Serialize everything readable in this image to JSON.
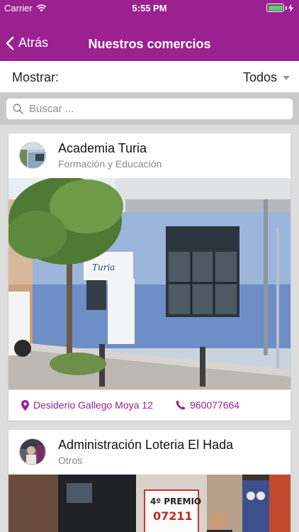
{
  "status_bar": {
    "carrier": "Carrier",
    "time": "5:55 PM",
    "wifi_icon": "wifi-icon",
    "battery_icon": "battery-charging-icon"
  },
  "nav": {
    "back_label": "Atrás",
    "title": "Nuestros comercios"
  },
  "filter": {
    "label": "Mostrar:",
    "selected": "Todos"
  },
  "search": {
    "placeholder": "Buscar ..."
  },
  "businesses": [
    {
      "name": "Academia Turia",
      "category": "Formación y Educación",
      "address": "Desiderio Gallego Moya 12",
      "phone": "960077664",
      "sign_text": "Turia"
    },
    {
      "name": "Administración Loteria El Hada",
      "category": "Otros",
      "sign_text_1": "4º PREMIO",
      "sign_text_2": "07211"
    }
  ],
  "colors": {
    "brand": "#9b2190",
    "background": "#dddddd",
    "battery": "#4cd964"
  }
}
